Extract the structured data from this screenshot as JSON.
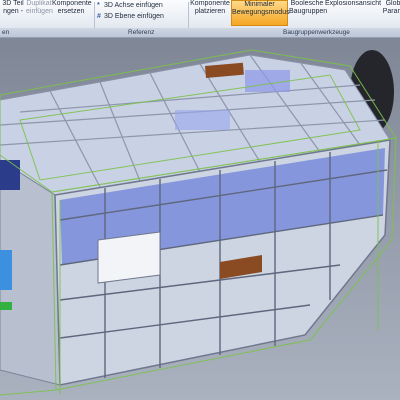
{
  "ribbon": {
    "buttons": [
      {
        "l1": "3D Teil",
        "l2": "ngen -"
      },
      {
        "l1": "Duplikat",
        "l2": "einfügen"
      },
      {
        "l1": "Komponente",
        "l2": "ersetzen"
      },
      {
        "l1": "Komponente",
        "l2": "platzieren"
      },
      {
        "l1": "Minimaler",
        "l2": "Bewegungsmodus"
      },
      {
        "l1": "Boolesche",
        "l2": "Baugruppen"
      },
      {
        "l1": "Explosionsansicht",
        "l2": ""
      },
      {
        "l1": "Glob",
        "l2": "Param"
      }
    ],
    "small_items": [
      {
        "label": "3D Achse einfügen",
        "icon": "axis-icon"
      },
      {
        "label": "3D Ebene einfügen",
        "icon": "plane-icon"
      }
    ],
    "groups": [
      "en",
      "Referenz",
      "Baugruppenwerkzeuge"
    ],
    "selected_button": "Bewegungsmodus",
    "accent_color": "#f5a623"
  },
  "viewport": {
    "background_color": "#8e98a8",
    "panel_color": "#c8d0e2",
    "glass_color": "#4a62d8",
    "highlight_color": "#7cc24a",
    "wood_color": "#8a4a22"
  }
}
